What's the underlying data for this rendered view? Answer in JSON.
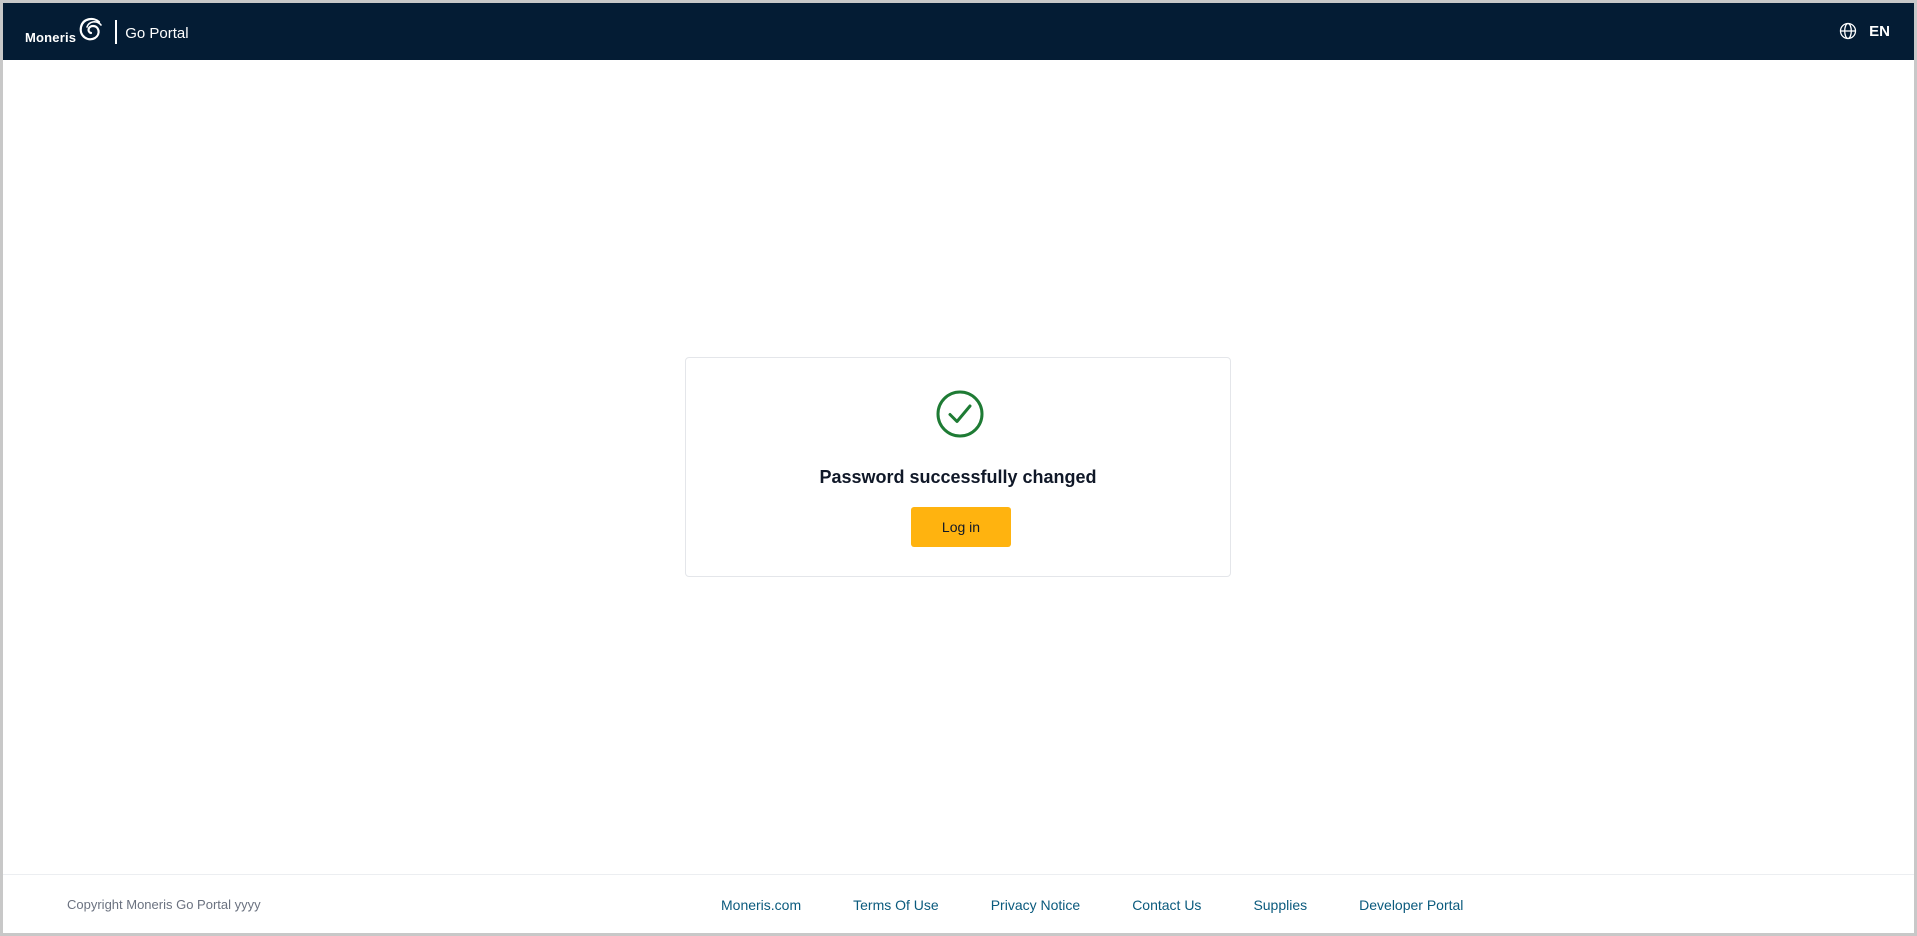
{
  "header": {
    "brand_name": "Moneris",
    "portal_name": "Go Portal",
    "language": "EN"
  },
  "card": {
    "title": "Password successfully changed",
    "login_label": "Log in"
  },
  "footer": {
    "copyright": "Copyright Moneris Go Portal  yyyy",
    "links": [
      {
        "label": "Moneris.com"
      },
      {
        "label": "Terms Of Use"
      },
      {
        "label": "Privacy Notice"
      },
      {
        "label": "Contact Us"
      },
      {
        "label": "Supplies"
      },
      {
        "label": "Developer Portal"
      }
    ]
  },
  "colors": {
    "header_bg": "#041c34",
    "button": "#ffb30f",
    "success": "#1e7b34",
    "link": "#0a5a7d"
  },
  "icons": [
    "moneris-swirl-icon",
    "globe-icon",
    "success-check-icon"
  ]
}
